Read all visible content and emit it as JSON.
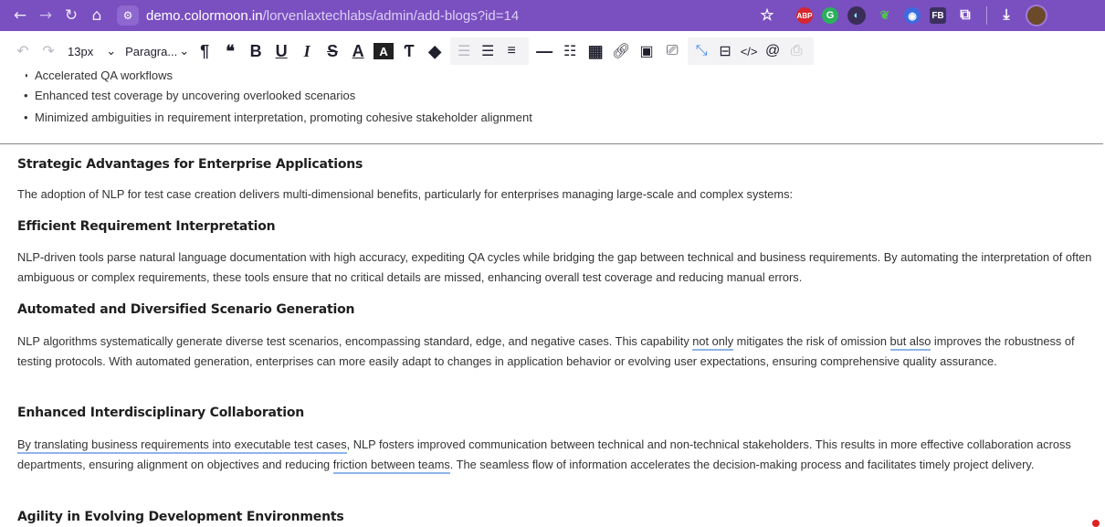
{
  "browser": {
    "url_host": "demo.colormoon.in",
    "url_path": "/lorvenlaxtechlabs/admin/add-blogs?id=14",
    "extensions": [
      "star-icon",
      "abp-extension",
      "grammarly-extension",
      "dark-extension",
      "green-extension",
      "blue-extension",
      "fb-extension",
      "puzzle-icon",
      "download-icon",
      "avatar"
    ],
    "accent_color": "#7a4fc0"
  },
  "toolbar": {
    "font_size": "13px",
    "paragraph_format": "Paragra...",
    "tools": [
      "undo-icon",
      "redo-icon",
      "pilcrow-icon",
      "quote-icon",
      "bold-icon",
      "underline-icon",
      "italic-icon",
      "strikethrough-icon",
      "text-color-icon",
      "background-color-icon",
      "clear-format-icon",
      "eraser-icon",
      "outdent-icon",
      "indent-icon",
      "align-icon",
      "horizontal-line-icon",
      "ordered-list-icon",
      "table-icon",
      "link-icon",
      "image-icon",
      "video-icon",
      "collapse-icon",
      "template-icon",
      "code-view-icon",
      "mention-icon",
      "save-icon"
    ]
  },
  "content": {
    "bullets": [
      "Accelerated QA workflows",
      "Enhanced test coverage by uncovering overlooked scenarios",
      "Minimized ambiguities in requirement interpretation, promoting cohesive stakeholder alignment"
    ],
    "sections": [
      {
        "heading": "Strategic Advantages for Enterprise Applications",
        "paragraph": "The adoption of NLP for test case creation delivers multi-dimensional benefits, particularly for enterprises managing large-scale and complex systems:"
      },
      {
        "heading": "Efficient Requirement Interpretation",
        "paragraph": "NLP-driven tools parse natural language documentation with high accuracy, expediting QA cycles while bridging the gap between technical and business requirements. By automating the interpretation of often ambiguous or complex requirements, these tools ensure that no critical details are missed, enhancing overall test coverage and reducing manual errors."
      },
      {
        "heading": "Automated and Diversified Scenario Generation",
        "p_a": "NLP algorithms systematically generate diverse test scenarios, encompassing standard, edge, and negative cases. This capability ",
        "p_u1": "not only",
        "p_b": " mitigates the risk of omission ",
        "p_u2": "but also",
        "p_c": " improves the robustness of testing protocols. With automated generation, enterprises can more easily adapt to changes in application behavior or evolving user expectations, ensuring comprehensive quality assurance."
      },
      {
        "heading": "Enhanced Interdisciplinary Collaboration",
        "p_u1": "By translating business requirements into executable test cases",
        "p_a": ", NLP fosters improved communication between technical and non-technical stakeholders. This results in more effective collaboration across departments, ensuring alignment on objectives and reducing ",
        "p_u2": "friction between teams",
        "p_b": ". The seamless flow of information accelerates the decision-making process and facilitates timely project delivery."
      },
      {
        "heading": "Agility in Evolving Development Environments"
      }
    ]
  }
}
